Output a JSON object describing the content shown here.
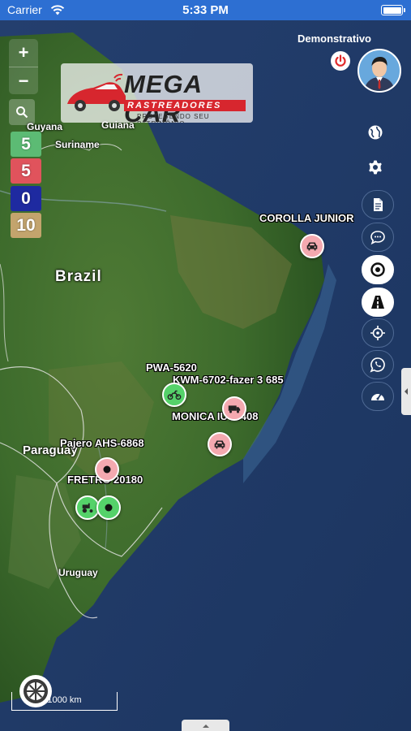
{
  "status_bar": {
    "carrier": "Carrier",
    "time": "5:33 PM"
  },
  "map": {
    "places": [
      "Guyana",
      "Guiana",
      "Suriname",
      "Brazil",
      "Paraguay",
      "Uruguay"
    ],
    "scale_label": "1000 km"
  },
  "zoom": {
    "in_label": "+",
    "out_label": "−"
  },
  "counters": [
    {
      "value": "5",
      "color": "#5cbb74"
    },
    {
      "value": "5",
      "color": "#e0535c"
    },
    {
      "value": "0",
      "color": "#1e2aa0"
    },
    {
      "value": "10",
      "color": "#c3a46d"
    }
  ],
  "logo": {
    "brand": "MEGA CAR",
    "sub": "RASTREADORES",
    "tagline": "PROTEGENDO SEU PATRIMÔNIO"
  },
  "user": {
    "name": "Demonstrativo"
  },
  "vehicles": [
    {
      "label": "COROLLA JUNIOR",
      "status": "red",
      "icon": "car-icon"
    },
    {
      "label": "PWA-5620",
      "status": "green",
      "icon": "motorcycle-icon"
    },
    {
      "label": "KWM-6702-fazer 3 685",
      "status": "red",
      "icon": "truck-icon"
    },
    {
      "label": "MONICA IUY0408",
      "status": "red",
      "icon": "car-icon"
    },
    {
      "label": "Pajero AHS-6868",
      "status": "red",
      "icon": "vehicle-icon"
    },
    {
      "label": "FRETRO 20180",
      "status": "green",
      "icon": "tractor-icon"
    }
  ],
  "tools": [
    "globe-icon",
    "gear-icon",
    "document-icon",
    "chat-icon",
    "target-icon",
    "road-icon",
    "crosshair-icon",
    "whatsapp-icon",
    "speedometer-icon"
  ],
  "colors": {
    "status_bar": "#2d6fd2",
    "marker_red": "#f4a9b0",
    "marker_green": "#55d26a"
  }
}
